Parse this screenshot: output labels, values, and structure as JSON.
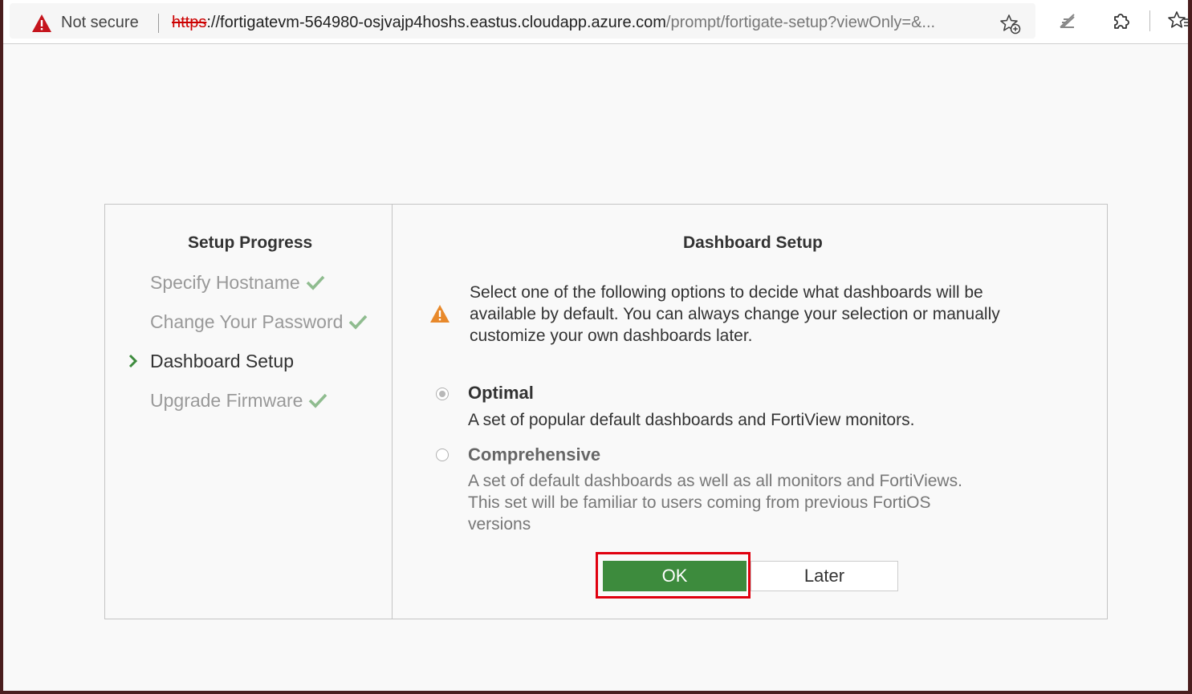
{
  "browser": {
    "security_label": "Not secure",
    "url_scheme": "https",
    "url_host": "://fortigatevm-564980-osjvajp4hoshs.eastus.cloudapp.azure.com",
    "url_path": "/prompt/fortigate-setup?viewOnly=&...",
    "icons": [
      "warning-icon",
      "add-favorite-icon",
      "reading-view-icon",
      "extensions-icon",
      "favorites-icon"
    ]
  },
  "setup": {
    "progress_title": "Setup Progress",
    "steps": [
      {
        "label": "Specify Hostname",
        "state": "done"
      },
      {
        "label": "Change Your Password",
        "state": "done"
      },
      {
        "label": "Dashboard Setup",
        "state": "current"
      },
      {
        "label": "Upgrade Firmware",
        "state": "done"
      }
    ]
  },
  "dashboard": {
    "title": "Dashboard Setup",
    "intro": "Select one of the following options to decide what dashboards will be available by default. You can always change your selection or manually customize your own dashboards later.",
    "options": [
      {
        "title": "Optimal",
        "description": "A set of popular default dashboards and FortiView monitors.",
        "selected": true
      },
      {
        "title": "Comprehensive",
        "description": "A set of default dashboards as well as all monitors and FortiViews. This set will be familiar to users coming from previous FortiOS versions",
        "selected": false
      }
    ],
    "ok_label": "OK",
    "later_label": "Later"
  },
  "colors": {
    "ok_button": "#3d8b3d",
    "check": "#8fbc8f",
    "warning": "#e8892b",
    "highlight": "#e0000f"
  }
}
